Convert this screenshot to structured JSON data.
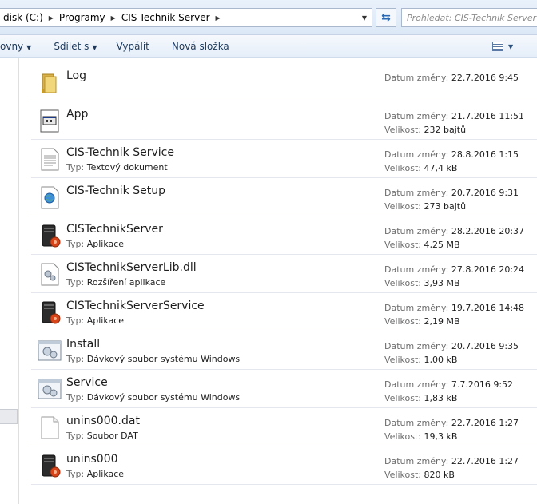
{
  "address": {
    "crumbs": [
      "disk (C:)",
      "Programy",
      "CIS-Technik Server"
    ],
    "search_placeholder": "Prohledat: CIS-Technik Server"
  },
  "toolbar": {
    "items": [
      "ovny",
      "Sdílet s",
      "Vypálit",
      "Nová složka"
    ]
  },
  "labels": {
    "date": "Datum změny:",
    "size": "Velikost:",
    "type": "Typ:"
  },
  "files": [
    {
      "name": "Log",
      "type": "",
      "date": "22.7.2016 9:45",
      "size": "",
      "icon": "folder-icon"
    },
    {
      "name": "App",
      "type": "",
      "date": "21.7.2016 11:51",
      "size": "232 bajtů",
      "icon": "config-file-icon"
    },
    {
      "name": "CIS-Technik Service",
      "type": "Textový dokument",
      "date": "28.8.2016 1:15",
      "size": "47,4 kB",
      "icon": "text-file-icon"
    },
    {
      "name": "CIS-Technik Setup",
      "type": "",
      "date": "20.7.2016 9:31",
      "size": "273 bajtů",
      "icon": "internet-shortcut-icon"
    },
    {
      "name": "CISTechnikServer",
      "type": "Aplikace",
      "date": "28.2.2016 20:37",
      "size": "4,25 MB",
      "icon": "server-app-icon"
    },
    {
      "name": "CISTechnikServerLib.dll",
      "type": "Rozšíření aplikace",
      "date": "27.8.2016 20:24",
      "size": "3,93 MB",
      "icon": "dll-file-icon"
    },
    {
      "name": "CISTechnikServerService",
      "type": "Aplikace",
      "date": "19.7.2016 14:48",
      "size": "2,19 MB",
      "icon": "server-app-icon"
    },
    {
      "name": "Install",
      "type": "Dávkový soubor systému Windows",
      "date": "20.7.2016 9:35",
      "size": "1,00 kB",
      "icon": "batch-file-icon"
    },
    {
      "name": "Service",
      "type": "Dávkový soubor systému Windows",
      "date": "7.7.2016 9:52",
      "size": "1,83 kB",
      "icon": "batch-file-icon"
    },
    {
      "name": "unins000.dat",
      "type": "Soubor DAT",
      "date": "22.7.2016 1:27",
      "size": "19,3 kB",
      "icon": "blank-file-icon"
    },
    {
      "name": "unins000",
      "type": "Aplikace",
      "date": "22.7.2016 1:27",
      "size": "820 kB",
      "icon": "server-app-icon"
    }
  ]
}
